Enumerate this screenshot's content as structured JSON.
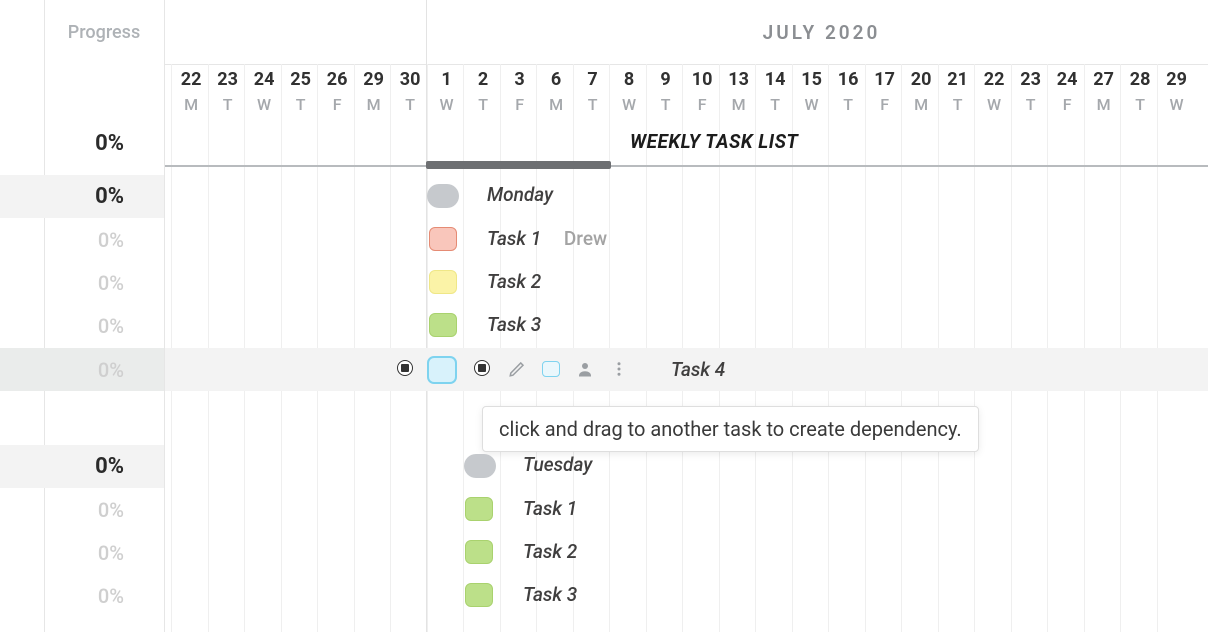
{
  "progress": {
    "header_label": "Progress",
    "rows": [
      {
        "value": "0%",
        "kind": "total"
      },
      {
        "value": "0%",
        "kind": "subtotal"
      },
      {
        "value": "0%",
        "kind": "task"
      },
      {
        "value": "0%",
        "kind": "task"
      },
      {
        "value": "0%",
        "kind": "task"
      },
      {
        "value": "0%",
        "kind": "task-selected"
      },
      {
        "value": "0%",
        "kind": "subtotal"
      },
      {
        "value": "0%",
        "kind": "task"
      },
      {
        "value": "0%",
        "kind": "task"
      },
      {
        "value": "0%",
        "kind": "task"
      }
    ]
  },
  "month_title": "JULY 2020",
  "date_columns": [
    {
      "d": "22",
      "w": "M"
    },
    {
      "d": "23",
      "w": "T"
    },
    {
      "d": "24",
      "w": "W"
    },
    {
      "d": "25",
      "w": "T"
    },
    {
      "d": "26",
      "w": "F"
    },
    {
      "d": "29",
      "w": "M"
    },
    {
      "d": "30",
      "w": "T"
    },
    {
      "d": "1",
      "w": "W"
    },
    {
      "d": "2",
      "w": "T"
    },
    {
      "d": "3",
      "w": "F"
    },
    {
      "d": "6",
      "w": "M"
    },
    {
      "d": "7",
      "w": "T"
    },
    {
      "d": "8",
      "w": "W"
    },
    {
      "d": "9",
      "w": "T"
    },
    {
      "d": "10",
      "w": "F"
    },
    {
      "d": "13",
      "w": "M"
    },
    {
      "d": "14",
      "w": "T"
    },
    {
      "d": "15",
      "w": "W"
    },
    {
      "d": "16",
      "w": "T"
    },
    {
      "d": "17",
      "w": "F"
    },
    {
      "d": "20",
      "w": "M"
    },
    {
      "d": "21",
      "w": "T"
    },
    {
      "d": "22",
      "w": "W"
    },
    {
      "d": "23",
      "w": "T"
    },
    {
      "d": "24",
      "w": "F"
    },
    {
      "d": "27",
      "w": "M"
    },
    {
      "d": "28",
      "w": "T"
    },
    {
      "d": "29",
      "w": "W"
    }
  ],
  "list_title": "WEEKLY TASK LIST",
  "groups": [
    {
      "name": "Monday",
      "chip_color": "gray",
      "tasks": [
        {
          "label": "Task 1",
          "chip": "red",
          "assignee": "Drew"
        },
        {
          "label": "Task 2",
          "chip": "yellow"
        },
        {
          "label": "Task 3",
          "chip": "green"
        },
        {
          "label": "Task 4",
          "chip": "blue",
          "selected": true
        }
      ]
    },
    {
      "name": "Tuesday",
      "chip_color": "gray",
      "tasks": [
        {
          "label": "Task 1",
          "chip": "green"
        },
        {
          "label": "Task 2",
          "chip": "green"
        },
        {
          "label": "Task 3",
          "chip": "green"
        }
      ]
    }
  ],
  "tooltip_text": "click and drag to another task to create dependency.",
  "action_icons": {
    "edit": "edit-icon",
    "color": "color-chip-icon",
    "assign": "person-icon",
    "more": "more-icon"
  }
}
